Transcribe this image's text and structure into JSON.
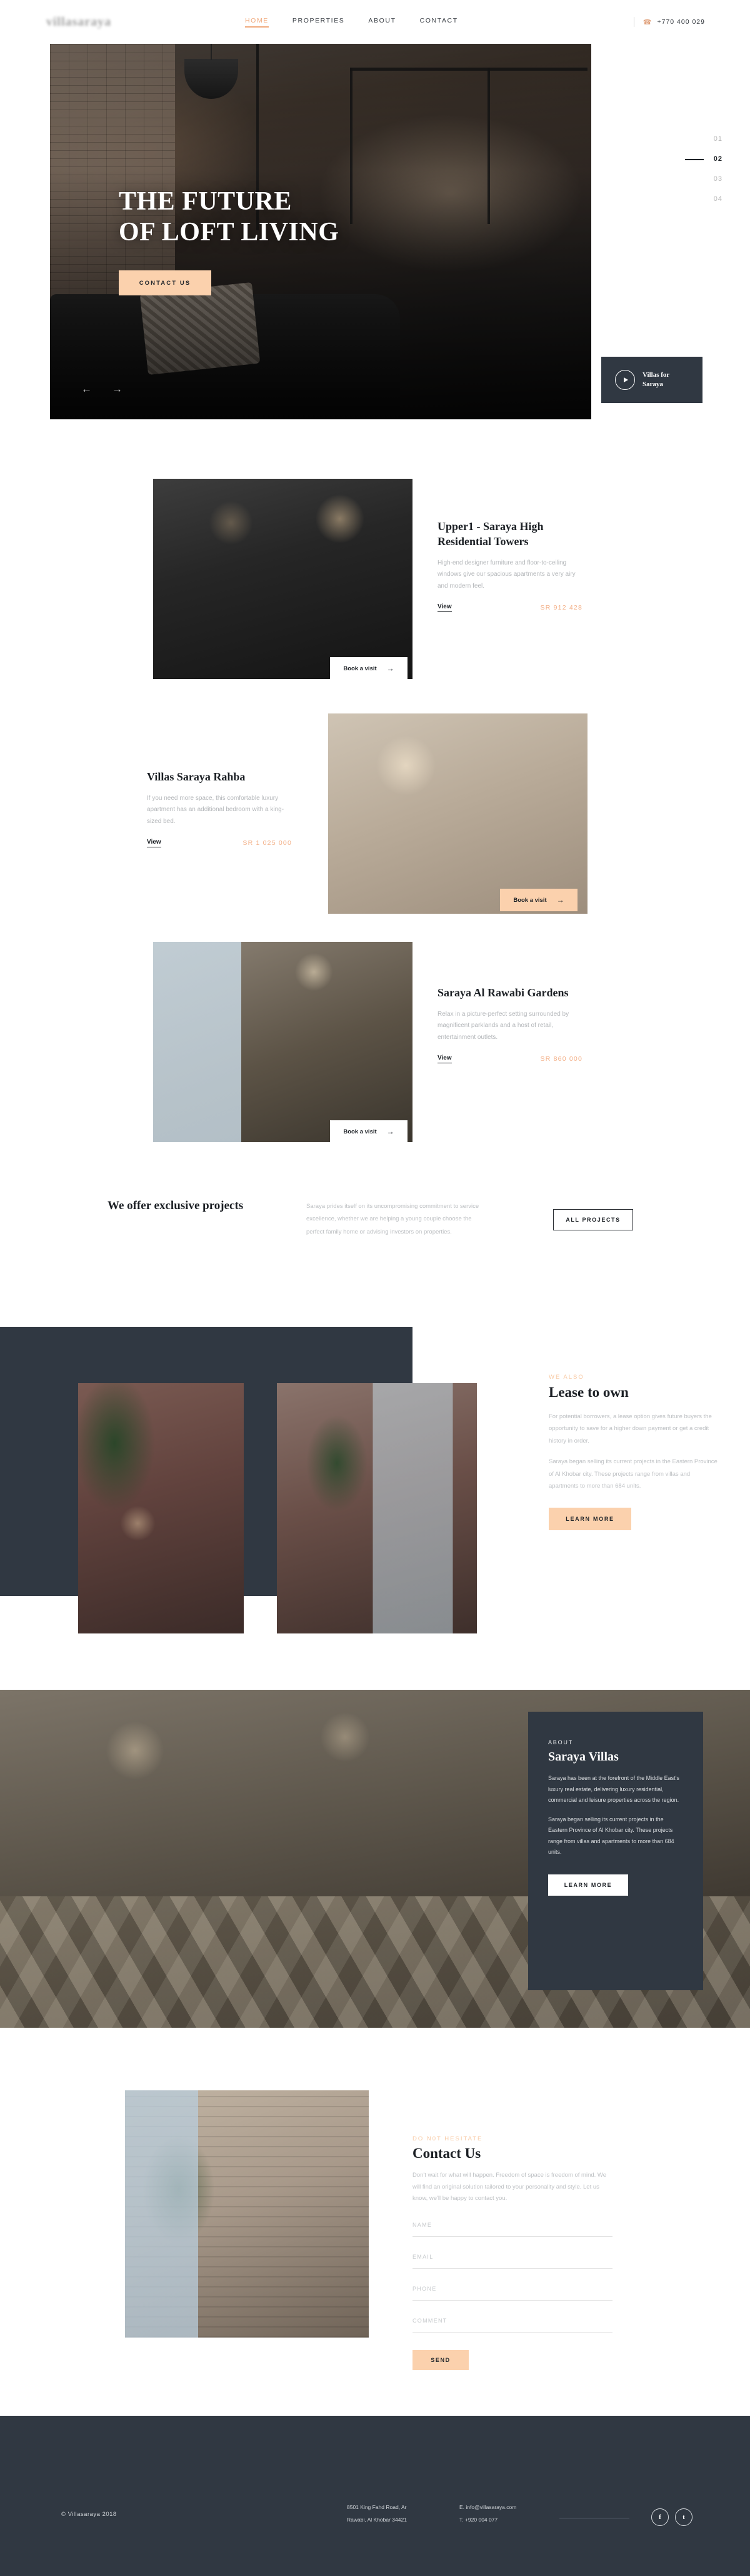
{
  "header": {
    "logo_text": "villasaraya",
    "nav": [
      {
        "label": "HOME",
        "active": true
      },
      {
        "label": "PROPERTIES",
        "active": false
      },
      {
        "label": "ABOUT",
        "active": false
      },
      {
        "label": "CONTACT",
        "active": false
      }
    ],
    "phone": "+770 400 029",
    "phone_icon": "phone-icon"
  },
  "hero": {
    "title_line1": "THE FUTURE",
    "title_line2": "OF LOFT LIVING",
    "cta": "CONTACT  US",
    "prev_icon": "arrow-left-icon",
    "next_icon": "arrow-right-icon",
    "pagination": [
      "01",
      "02",
      "03",
      "04"
    ],
    "pagination_active": "02",
    "video_card": {
      "label_line1": "Villas for",
      "label_line2": "Saraya",
      "play_icon": "play-icon"
    }
  },
  "properties": [
    {
      "title": "Upper1 - Saraya High Residential Towers",
      "desc": "High-end designer furniture and floor-to-ceiling windows give our spacious apartments a very airy and modern feel.",
      "view_label": "View",
      "price": "SR 912 428",
      "book_label": "Book a visit",
      "book_arrow": "→"
    },
    {
      "title": "Villas Saraya Rahba",
      "desc": "If you need more space, this comfortable luxury apartment has an additional bedroom with a king-sized bed.",
      "view_label": "View",
      "price": "SR 1 025 000",
      "book_label": "Book a visit",
      "book_arrow": "→"
    },
    {
      "title": "Saraya Al Rawabi Gardens",
      "desc": "Relax in a picture-perfect setting surrounded by magnificent parklands and a host of retail, entertainment outlets.",
      "view_label": "View",
      "price": "SR 860 000",
      "book_label": "Book a visit",
      "book_arrow": "→"
    }
  ],
  "exclusive": {
    "title": "We offer exclusive projects",
    "body": "Saraya prides itself on its uncompromising commitment to service excellence, whether we are helping a young couple choose the perfect family home or advising investors on properties.",
    "button": "ALL PROJECTS"
  },
  "lease": {
    "kicker": "WE ALSO",
    "title": "Lease to own",
    "paragraph1": "For potential borrowers, a lease option gives future buyers the opportunity to save for a higher down payment or get a credit history in order.",
    "paragraph2": "Saraya began selling its current projects in the Eastern Province of Al Khobar city. These projects range from villas and apartments to more than 684 units.",
    "button": "LEARN MORE"
  },
  "about": {
    "kicker": "ABOUT",
    "title": "Saraya Villas",
    "paragraph1": "Saraya has been at the forefront of the Middle East's luxury real estate, delivering luxury residential, commercial and leisure properties across the region.",
    "paragraph2": "Saraya began selling its current projects in the Eastern Province of Al Khobar city. These projects range from villas and apartments to more than 684 units.",
    "button": "LEARN MORE"
  },
  "contact": {
    "kicker": "DO N0T HESITATE",
    "title": "Contact Us",
    "body": "Don't wait for what will happen. Freedom of space is freedom of mind. We will find an original solution tailored to your personality and style. Let us know, we'll be happy to contact you.",
    "fields": [
      {
        "placeholder": "NAME",
        "value": ""
      },
      {
        "placeholder": "EMAIL",
        "value": ""
      },
      {
        "placeholder": "PHONE",
        "value": ""
      },
      {
        "placeholder": "COMMENT",
        "value": ""
      }
    ],
    "send_label": "SEND"
  },
  "footer": {
    "copyright": "© Villasaraya 2018",
    "address_line1": "8501 King Fahd Road, Ar",
    "address_line2": "Rawabi, Al Khobar 34421",
    "email": "E. info@villasaraya.com",
    "phone": "T. +920 004 077",
    "social": [
      {
        "name": "facebook-icon",
        "glyph": "f"
      },
      {
        "name": "twitter-icon",
        "glyph": "t"
      }
    ]
  },
  "colors": {
    "accent_peach": "#fbd1ad",
    "accent_peach_text": "#f3b088",
    "dark_navy": "#303842",
    "ink": "#1b1f24"
  }
}
